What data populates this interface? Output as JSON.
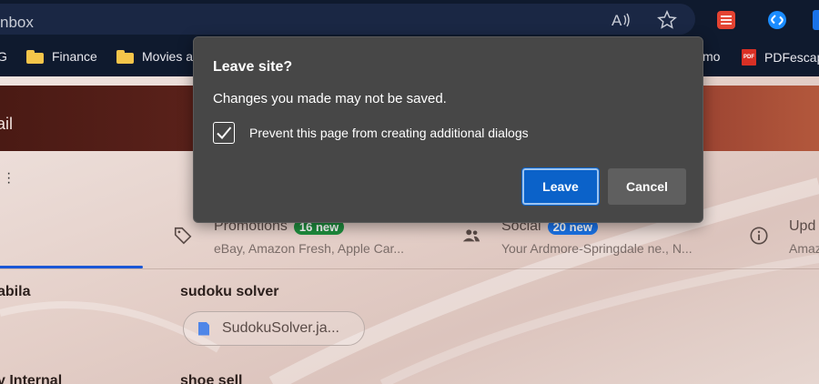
{
  "browser": {
    "address_text": "nbox",
    "bookmarks": [
      {
        "label": "G"
      },
      {
        "label": "Finance"
      },
      {
        "label": "Movies a"
      },
      {
        "label": "mo"
      },
      {
        "label": "PDFescap"
      }
    ],
    "pdf_icon_text": "PDF"
  },
  "page": {
    "banner_text": "ail",
    "tabs": [
      {
        "title": "Promotions",
        "badge": "16 new",
        "subtitle": "eBay, Amazon Fresh, Apple Car...",
        "badge_color": "#1e8e3e"
      },
      {
        "title": "Social",
        "badge": "20 new",
        "subtitle": "Your Ardmore-Springdale ne., N...",
        "badge_color": "#1a73e8"
      },
      {
        "title": "Upd",
        "subtitle": "Amaz"
      }
    ],
    "rows": [
      {
        "sender": "abila",
        "subject": "sudoku solver",
        "attachment": "SudokuSolver.ja..."
      },
      {
        "sender": "y Internal",
        "subject": "shoe sell"
      }
    ]
  },
  "dialog": {
    "title": "Leave site?",
    "message": "Changes you made may not be saved.",
    "checkbox_label": "Prevent this page from creating additional dialogs",
    "checkbox_checked": true,
    "leave_label": "Leave",
    "cancel_label": "Cancel"
  }
}
